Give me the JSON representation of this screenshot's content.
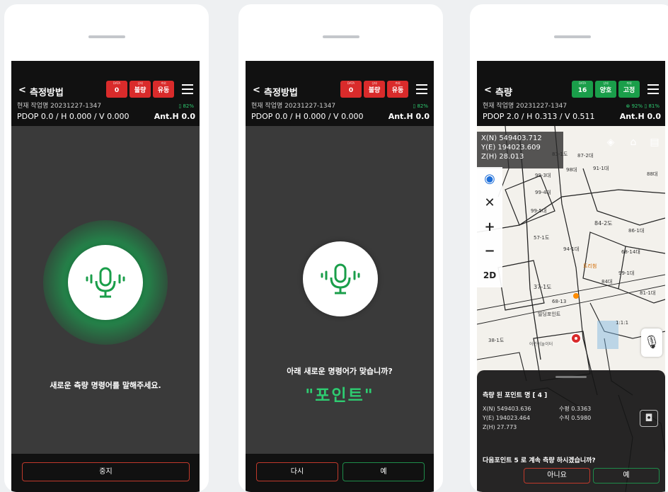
{
  "screens": [
    {
      "title": "측정방법",
      "badges": [
        {
          "label": "DATA",
          "value": "0",
          "color": "#d92b2b"
        },
        {
          "label": "상태",
          "value": "불량",
          "color": "#d92b2b"
        },
        {
          "label": "측위",
          "value": "유동",
          "color": "#d92b2b"
        }
      ],
      "job": "현재 작업명 20231227-1347",
      "battery": "82%",
      "pdop": "PDOP 0.0 / H 0.000 / V 0.000",
      "anth": "Ant.H 0.0",
      "prompt": "새로운 측량 명령어를 말해주세요.",
      "stop_button": "중지"
    },
    {
      "title": "측정방법",
      "badges": [
        {
          "label": "DATA",
          "value": "0",
          "color": "#d92b2b"
        },
        {
          "label": "상태",
          "value": "불량",
          "color": "#d92b2b"
        },
        {
          "label": "측위",
          "value": "유동",
          "color": "#d92b2b"
        }
      ],
      "job": "현재 작업명 20231227-1347",
      "battery": "82%",
      "pdop": "PDOP 0.0 / H 0.000 / V 0.000",
      "anth": "Ant.H 0.0",
      "prompt": "아래 새로운 명령어가 맞습니까?",
      "answer": "\"포인트\"",
      "retry_button": "다시",
      "yes_button": "예"
    },
    {
      "title": "측량",
      "badges": [
        {
          "label": "DATA",
          "value": "16",
          "color": "#1a9e4a"
        },
        {
          "label": "상태",
          "value": "양호",
          "color": "#1a9e4a"
        },
        {
          "label": "측위",
          "value": "고정",
          "color": "#1a9e4a"
        }
      ],
      "job": "현재 작업명 20231227-1347",
      "sat": "92%",
      "battery": "81%",
      "pdop": "PDOP 2.0 / H 0.313 / V 0.511",
      "anth": "Ant.H 0.0",
      "coords": [
        "X(N) 549403.712",
        "Y(E) 194023.609",
        "Z(H) 28.013"
      ],
      "zoom_mode": "2D",
      "sheet_title": "측량 된 포인트 명 [ 4 ]",
      "point_coords": [
        "X(N) 549403.636",
        "Y(E) 194023.464",
        "Z(H) 27.773"
      ],
      "point_dev": [
        "수평 0.3363",
        "수직 0.5980"
      ],
      "question": "다음포인트 5 로 계속 측량 하시겠습니까?",
      "no_button": "아니요",
      "yes_button": "예",
      "map_labels": [
        "99-3대",
        "98대",
        "99-4대",
        "99-5대",
        "57-1도",
        "94-1대",
        "84-2도",
        "86-1대",
        "88대",
        "68-14대",
        "99-1대",
        "81-1대",
        "37-1도",
        "68-13",
        "빌딩포인트",
        "38-1도",
        "84대",
        "83-1도",
        "87-2대",
        "91-1대",
        "어린이놀이터",
        "트리첨",
        "1:1:1"
      ]
    }
  ]
}
